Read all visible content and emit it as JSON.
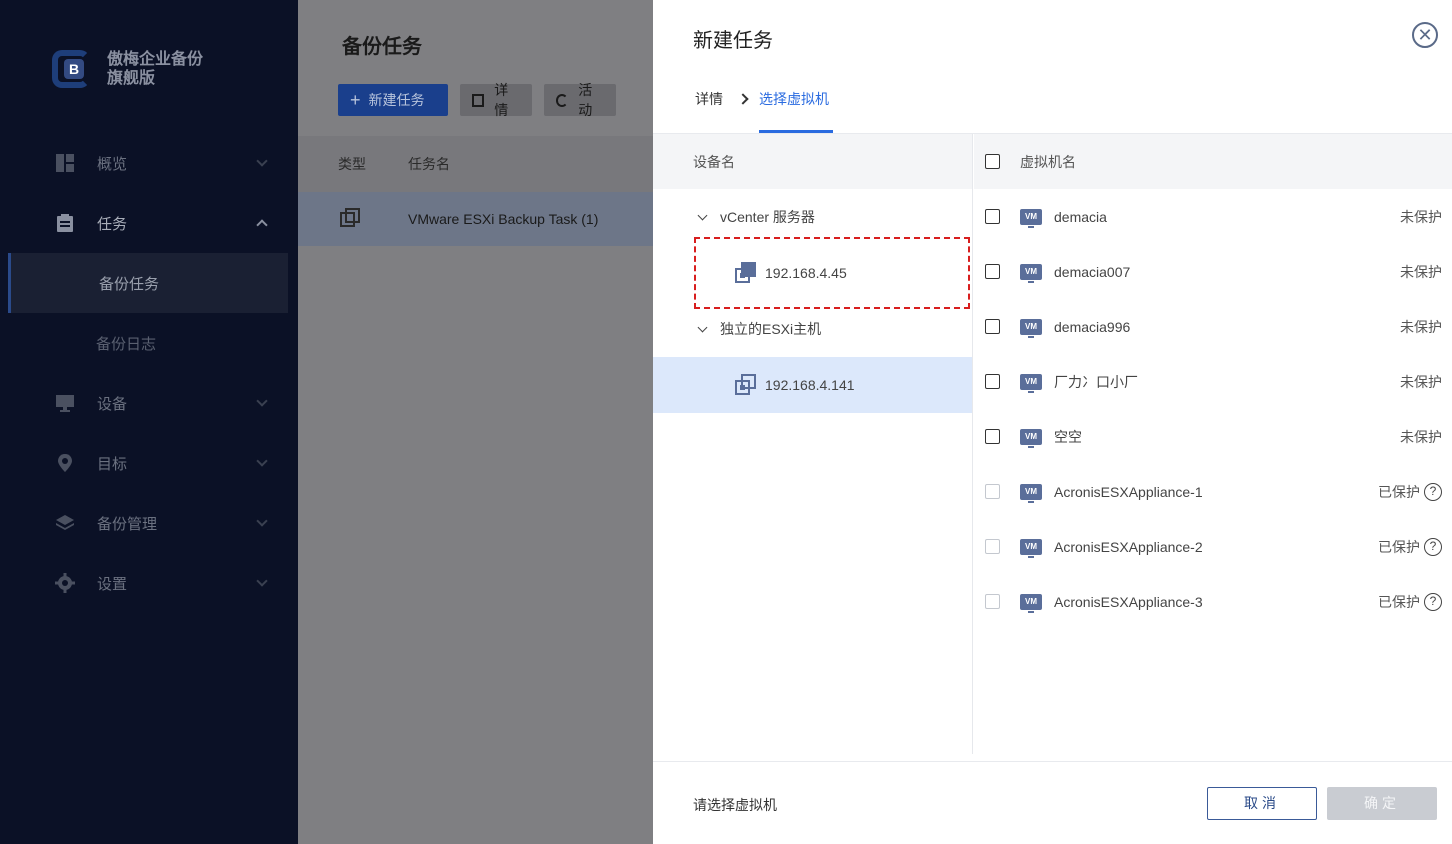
{
  "brand": {
    "name_line1": "傲梅企业备份",
    "name_line2": "旗舰版",
    "logo_letter": "B"
  },
  "nav": {
    "overview": "概览",
    "tasks": "任务",
    "backup_tasks": "备份任务",
    "backup_log": "备份日志",
    "devices": "设备",
    "targets": "目标",
    "backup_mgmt": "备份管理",
    "settings": "设置"
  },
  "main": {
    "title": "备份任务",
    "new_task_button": "新建任务",
    "details_button": "详情",
    "activity_button": "活动",
    "col_type": "类型",
    "col_task_name": "任务名",
    "row_task_name": "VMware ESXi Backup Task (1)"
  },
  "drawer": {
    "title": "新建任务",
    "crumb_details": "详情",
    "crumb_select_vm": "选择虚拟机",
    "device_header": "设备名",
    "vm_header": "虚拟机名",
    "tree": {
      "vcenter_group": "vCenter 服务器",
      "vcenter_host": "192.168.4.45",
      "esxi_group": "独立的ESXi主机",
      "esxi_host": "192.168.4.141"
    },
    "vm_icon_label": "VM",
    "vms": [
      {
        "name": "demacia",
        "status": "未保护",
        "disabled": false
      },
      {
        "name": "demacia007",
        "status": "未保护",
        "disabled": false
      },
      {
        "name": "demacia996",
        "status": "未保护",
        "disabled": false
      },
      {
        "name": "⼚⼒⼎⼝⼩⼚",
        "status": "未保护",
        "disabled": false
      },
      {
        "name": "空空",
        "status": "未保护",
        "disabled": false
      },
      {
        "name": "AcronisESXAppliance-1",
        "status": "已保护",
        "disabled": true
      },
      {
        "name": "AcronisESXAppliance-2",
        "status": "已保护",
        "disabled": true
      },
      {
        "name": "AcronisESXAppliance-3",
        "status": "已保护",
        "disabled": true
      }
    ],
    "footer_hint": "请选择虚拟机",
    "cancel_button": "取消",
    "ok_button": "确定"
  },
  "colors": {
    "accent": "#2a6be0",
    "highlight_dash": "#d81e1e",
    "sidebar_bg": "#0b1126"
  }
}
